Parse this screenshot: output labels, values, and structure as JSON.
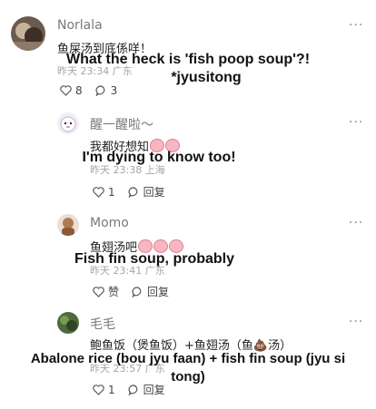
{
  "comments": [
    {
      "name": "Norlala",
      "text": "鱼屎汤到底係咩！",
      "time": "昨天 23:34",
      "location": "广东",
      "likes": "8",
      "replies": "3",
      "overlay": [
        "What the heck is 'fish poop soup'?!",
        "*jyusitong"
      ]
    },
    {
      "name": "醒一醒啦～",
      "text": "我都好想知",
      "time": "昨天 23:38",
      "location": "上海",
      "likes": "1",
      "reply_label": "回复",
      "overlay": [
        "I'm dying to know too!"
      ]
    },
    {
      "name": "Momo",
      "text": "鱼翅汤吧",
      "time": "昨天 23:41",
      "location": "广东",
      "like_label": "赞",
      "reply_label": "回复",
      "overlay": [
        "Fish fin soup, probably"
      ]
    },
    {
      "name": "毛毛",
      "text": "鲍鱼饭（煲鱼饭）+鱼翅汤（鱼💩汤）",
      "time": "昨天 23:57",
      "location": "广东",
      "likes": "1",
      "reply_label": "回复",
      "overlay": [
        "Abalone rice (bou jyu faan) + fish fin soup (jyu si",
        "tong)"
      ]
    }
  ],
  "icons": {
    "more": "more-horizontal-icon",
    "like": "heart-outline-icon",
    "reply": "speech-bubble-icon",
    "emoji": "pig-face-emoji"
  },
  "more_glyph": "···"
}
